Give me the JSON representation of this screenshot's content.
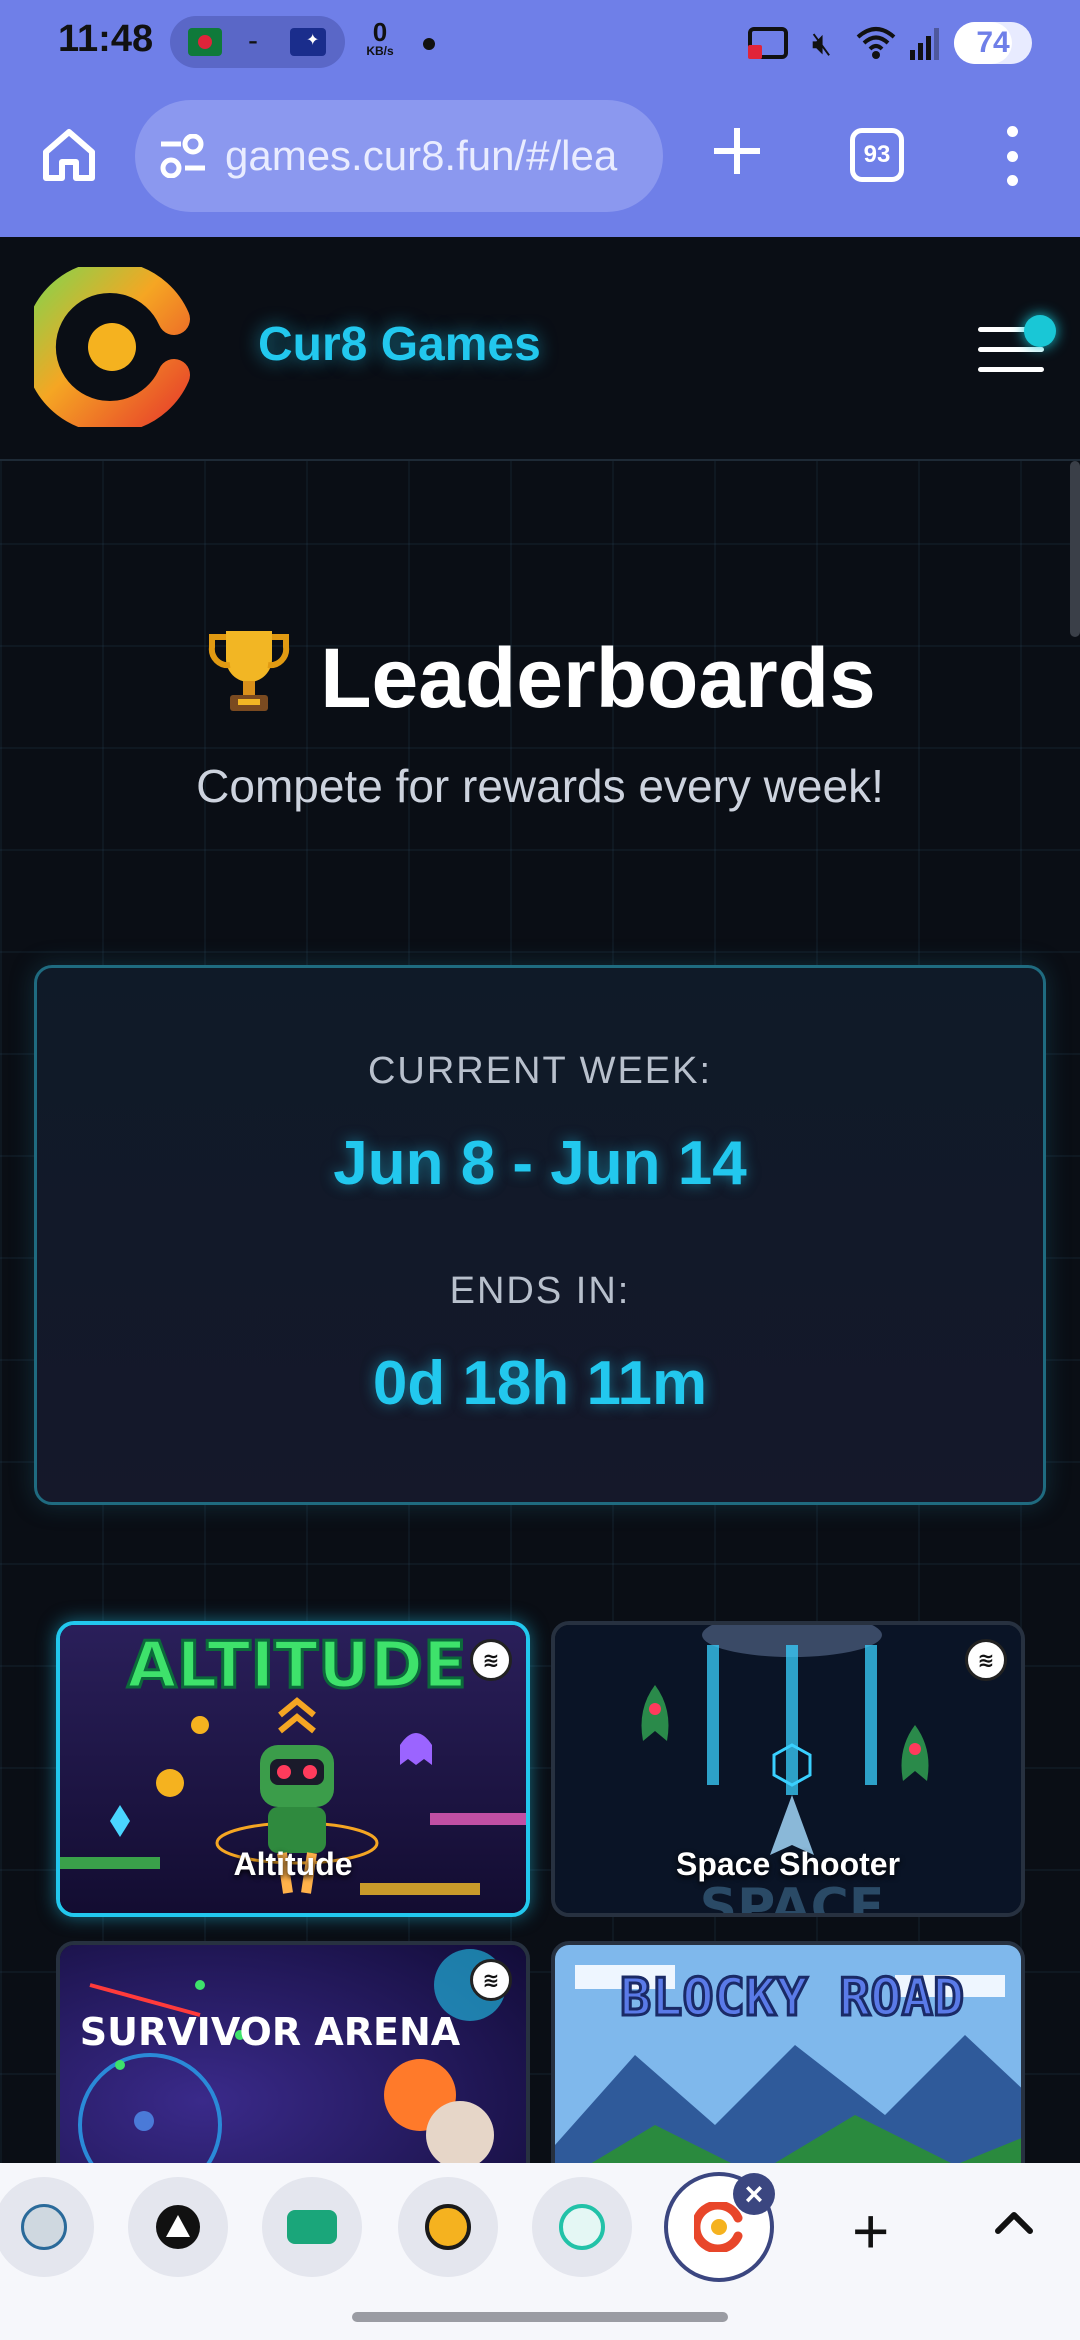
{
  "status_bar": {
    "time": "11:48",
    "net_dash": "-",
    "speed_value": "0",
    "speed_unit": "KB/s",
    "battery": "74",
    "battery_fraction": 0.74
  },
  "browser": {
    "url": "games.cur8.fun/#/lea",
    "tab_count": "93"
  },
  "site": {
    "name": "Cur8 Games"
  },
  "leaderboards": {
    "title": "Leaderboards",
    "subtitle": "Compete for rewards every week!",
    "current_week_label": "CURRENT WEEK:",
    "current_week": "Jun 8 - Jun 14",
    "ends_in_label": "ENDS IN:",
    "ends_in": "0d 18h 11m"
  },
  "games": [
    {
      "name": "Altitude",
      "art_text": "ALTITUDE"
    },
    {
      "name": "Space Shooter",
      "art_text": "SPACE"
    },
    {
      "name": "",
      "art_text": "SURVIVOR ARENA"
    },
    {
      "name": "",
      "art_text": "BLOCKY ROAD"
    }
  ],
  "colors": {
    "toolbar": "#6f7fe8",
    "accent": "#22c8ee",
    "page_bg": "#0a0e15"
  },
  "icons": {
    "home": "home-icon",
    "site_settings": "tune-icon",
    "new_tab": "plus-icon",
    "more": "more-vert-icon",
    "menu": "hamburger-icon",
    "trophy": "trophy-icon",
    "steem": "steem-icon"
  }
}
